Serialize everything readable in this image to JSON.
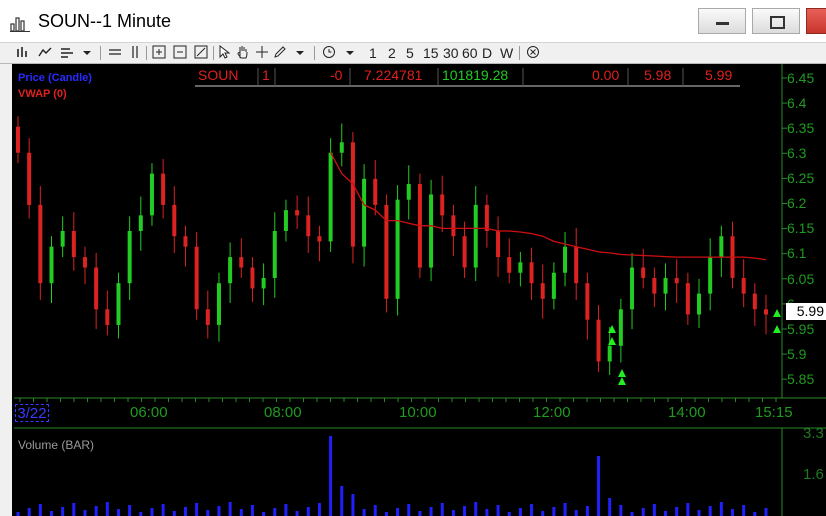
{
  "window": {
    "title": "SOUN--1 Minute",
    "colors": {
      "bg": "#000000",
      "grid": "#2a8a2a",
      "axis_text": "#1f9a1f",
      "vwap": "#d01010",
      "up": "#22cc22",
      "down": "#dd2222",
      "volume": "#2020ff"
    }
  },
  "toolbar": {
    "items": [
      "bar-chart-icon",
      "line-chart-icon",
      "candle-chart-icon",
      "dropdown-arrow-icon",
      "hline-icon",
      "vline-icon",
      "zoom-in-icon",
      "zoom-out-icon",
      "zoom-fit-icon",
      "cursor-icon",
      "hand-icon",
      "crosshair-icon",
      "pen-icon",
      "dropdown-arrow-icon",
      "clock-icon",
      "dropdown-arrow-icon"
    ],
    "intervals": [
      "1",
      "2",
      "5",
      "15",
      "30",
      "60",
      "D",
      "W"
    ],
    "close_icon": "close-circle-icon"
  },
  "legend": {
    "price": "Price (Candle)",
    "vwap": "VWAP (0)"
  },
  "quote": {
    "symbol": "SOUN",
    "field1": "1",
    "change": "-0",
    "value": "7.224781",
    "volume": "101819.28",
    "pct": "0.00",
    "bid": "5.98",
    "ask": "5.99"
  },
  "price_axis": {
    "ticks": [
      "6.45",
      "6.4",
      "6.35",
      "6.3",
      "6.25",
      "6.2",
      "6.15",
      "6.1",
      "6.05",
      "6",
      "5.95",
      "5.9",
      "5.85"
    ],
    "current": "5.99"
  },
  "time_axis": {
    "date": "3/22",
    "ticks": [
      "06:00",
      "08:00",
      "10:00",
      "12:00",
      "14:00",
      "15:15"
    ]
  },
  "volume_panel": {
    "label": "Volume (BAR)",
    "ticks": [
      "3.3",
      "1.6"
    ]
  },
  "chart_data": {
    "type": "candlestick",
    "ylim": [
      5.83,
      6.47
    ],
    "vwap_label": "VWAP (0)",
    "price_label": "Price (Candle)",
    "series": [
      {
        "name": "Price (Candle)",
        "close": [
          6.3,
          6.2,
          6.05,
          6.12,
          6.15,
          6.1,
          6.08,
          6.0,
          5.97,
          6.05,
          6.15,
          6.18,
          6.26,
          6.2,
          6.14,
          6.12,
          6.0,
          5.97,
          6.05,
          6.1,
          6.08,
          6.04,
          6.06,
          6.15,
          6.19,
          6.18,
          6.14,
          6.13,
          6.3,
          6.32,
          6.12,
          6.25,
          6.2,
          6.02,
          6.21,
          6.24,
          6.08,
          6.22,
          6.18,
          6.14,
          6.08,
          6.2,
          6.15,
          6.1,
          6.07,
          6.09,
          6.05,
          6.02,
          6.07,
          6.12,
          6.05,
          5.98,
          5.9,
          5.93,
          6.0,
          6.08,
          6.06,
          6.03,
          6.06,
          6.05,
          5.99,
          6.03,
          6.1,
          6.14,
          6.06,
          6.03,
          6.0,
          5.99
        ]
      },
      {
        "name": "VWAP (0)",
        "values": [
          null,
          null,
          null,
          null,
          null,
          null,
          null,
          null,
          null,
          null,
          null,
          null,
          null,
          null,
          null,
          null,
          null,
          null,
          null,
          null,
          null,
          null,
          null,
          null,
          null,
          null,
          null,
          null,
          6.3,
          6.26,
          6.24,
          6.2,
          6.19,
          6.17,
          6.17,
          6.165,
          6.16,
          6.16,
          6.155,
          6.155,
          6.155,
          6.155,
          6.155,
          6.15,
          6.15,
          6.148,
          6.145,
          6.14,
          6.13,
          6.125,
          6.12,
          6.115,
          6.11,
          6.108,
          6.105,
          6.104,
          6.103,
          6.102,
          6.101,
          6.1,
          6.1,
          6.1,
          6.1,
          6.1,
          6.1,
          6.1,
          6.098,
          6.095
        ]
      }
    ]
  }
}
